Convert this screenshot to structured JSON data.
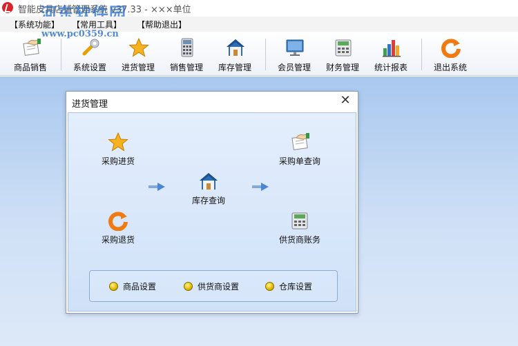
{
  "window": {
    "title": "智能皮具店铺管理系统 v37.33 - ×××单位"
  },
  "watermark": {
    "text": "河东软件园",
    "url": "www.pc0359.cn"
  },
  "menu": [
    {
      "label": "【系统功能】"
    },
    {
      "label": "【常用工具】"
    },
    {
      "label": "【帮助退出】"
    }
  ],
  "toolbar": [
    {
      "label": "商品销售",
      "icon": "hand-document-icon"
    },
    {
      "label": "系统设置",
      "icon": "wrench-icon"
    },
    {
      "label": "进货管理",
      "icon": "star-icon"
    },
    {
      "label": "销售管理",
      "icon": "calculator-icon"
    },
    {
      "label": "库存管理",
      "icon": "house-icon"
    },
    {
      "label": "会员管理",
      "icon": "monitor-icon"
    },
    {
      "label": "财务管理",
      "icon": "cash-register-icon"
    },
    {
      "label": "统计报表",
      "icon": "bar-chart-icon"
    },
    {
      "label": "退出系统",
      "icon": "exit-refresh-icon"
    }
  ],
  "dialog": {
    "title": "进货管理",
    "close": "✕",
    "functions": {
      "purchase_in": "采购进货",
      "purchase_query": "采购单查询",
      "stock_query": "库存查询",
      "purchase_return": "采购退货",
      "supplier_account": "供货商账务"
    },
    "settings": [
      {
        "label": "商品设置"
      },
      {
        "label": "供货商设置"
      },
      {
        "label": "仓库设置"
      }
    ]
  },
  "colors": {
    "workspace_top": "#a9c8ee",
    "workspace_bottom": "#dde9f8",
    "accent_blue": "#2a6fc7",
    "star_orange": "#f2a11d",
    "exit_orange": "#f07b12"
  }
}
